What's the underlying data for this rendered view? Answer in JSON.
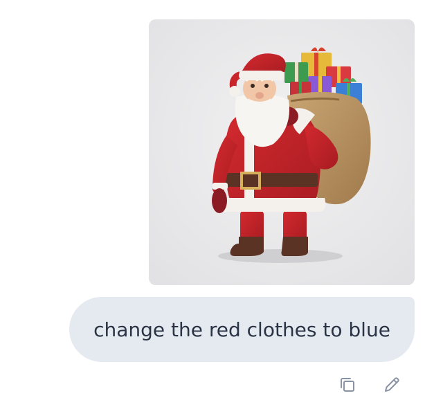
{
  "message": {
    "text": "change the red clothes to blue",
    "attachment": {
      "subject": "santa-claus-with-gift-sack",
      "background_color": "#e9e9ea"
    }
  },
  "actions": [
    {
      "icon": "copy-icon"
    },
    {
      "icon": "edit-pencil-icon"
    }
  ],
  "colors": {
    "bubble_bg": "#e5e9f0",
    "text": "#2b3445",
    "icon": "#8a93a3"
  }
}
